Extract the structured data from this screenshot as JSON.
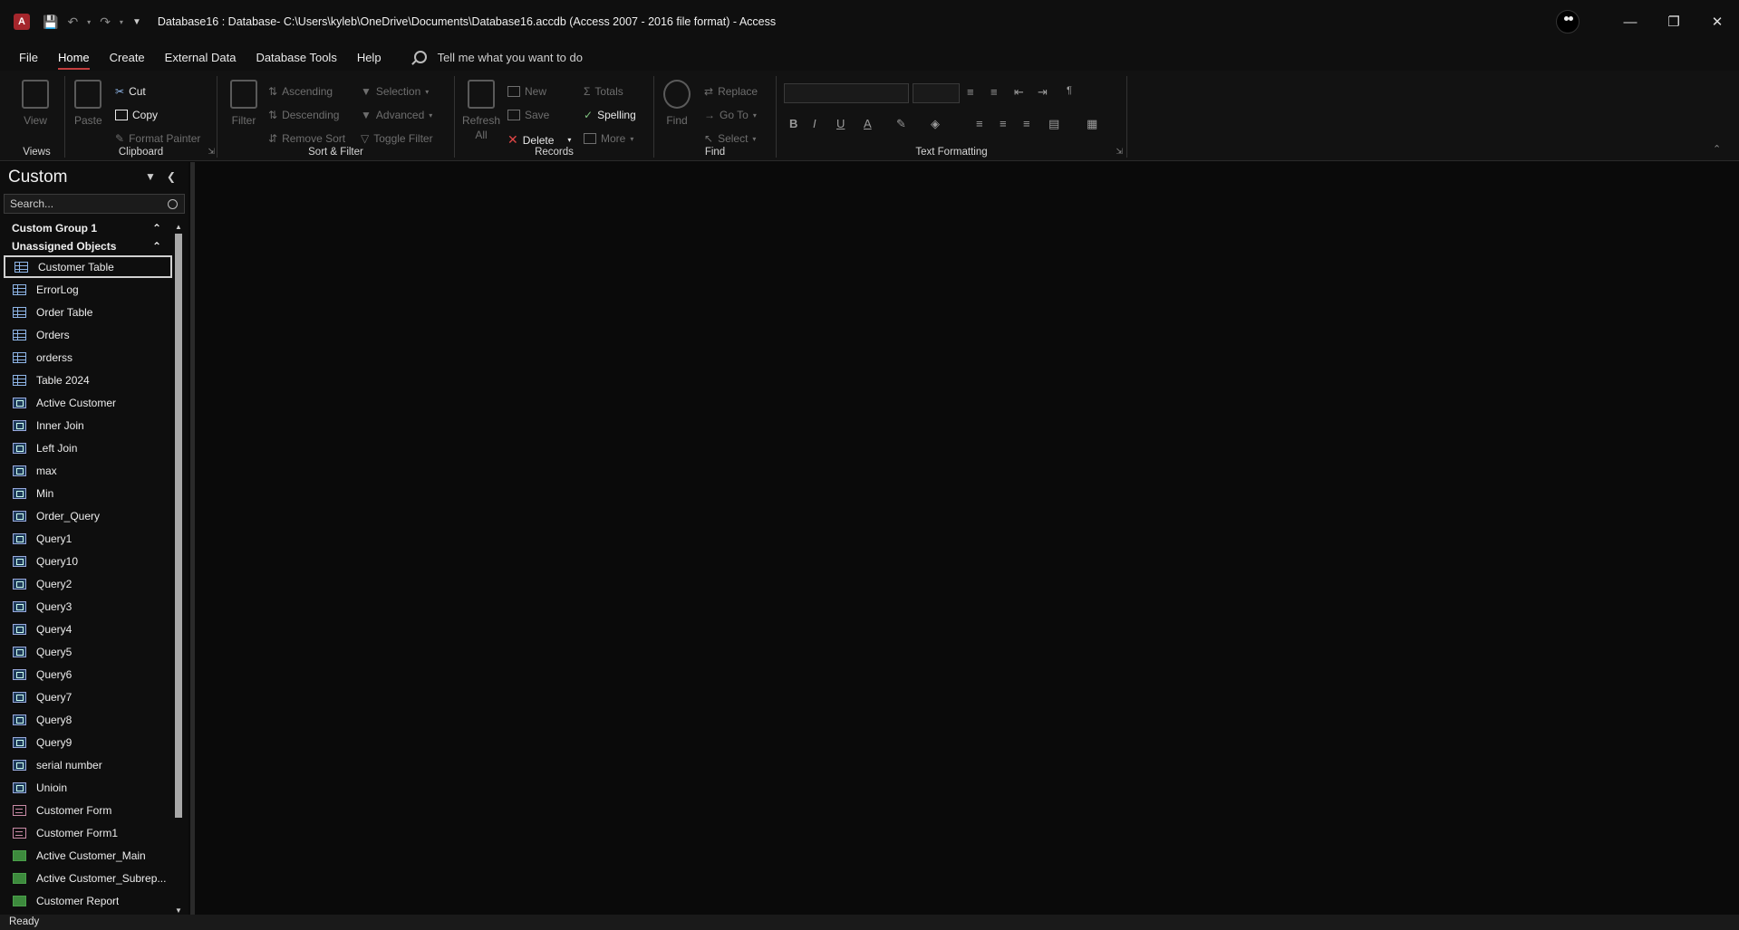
{
  "window": {
    "title": "Database16 : Database- C:\\Users\\kyleb\\OneDrive\\Documents\\Database16.accdb (Access 2007 - 2016 file format)  -  Access",
    "app_icon_letter": "A"
  },
  "menu": {
    "tabs": [
      {
        "label": "File"
      },
      {
        "label": "Home"
      },
      {
        "label": "Create"
      },
      {
        "label": "External Data"
      },
      {
        "label": "Database Tools"
      },
      {
        "label": "Help"
      }
    ],
    "active_tab": "Home",
    "tellme": "Tell me what you want to do"
  },
  "ribbon": {
    "views": {
      "label": "Views",
      "view": "View"
    },
    "clipboard": {
      "label": "Clipboard",
      "paste": "Paste",
      "cut": "Cut",
      "copy": "Copy",
      "format_painter": "Format Painter"
    },
    "sort_filter": {
      "label": "Sort & Filter",
      "filter": "Filter",
      "ascending": "Ascending",
      "descending": "Descending",
      "remove_sort": "Remove Sort",
      "selection": "Selection",
      "advanced": "Advanced",
      "toggle_filter": "Toggle Filter"
    },
    "records": {
      "label": "Records",
      "refresh": "Refresh",
      "refresh_all": "All",
      "new": "New",
      "save": "Save",
      "delete": "Delete",
      "totals": "Totals",
      "spelling": "Spelling",
      "more": "More"
    },
    "find": {
      "label": "Find",
      "find": "Find",
      "replace": "Replace",
      "goto": "Go To",
      "select": "Select"
    },
    "text_formatting": {
      "label": "Text Formatting",
      "bold": "B",
      "italic": "I",
      "underline": "U",
      "font_color": "A"
    }
  },
  "nav": {
    "title": "Custom",
    "search_placeholder": "Search...",
    "groups": [
      {
        "label": "Custom Group 1"
      },
      {
        "label": "Unassigned Objects"
      }
    ],
    "items": [
      {
        "label": "Customer Table",
        "type": "table"
      },
      {
        "label": "ErrorLog",
        "type": "table"
      },
      {
        "label": "Order Table",
        "type": "table"
      },
      {
        "label": "Orders",
        "type": "table"
      },
      {
        "label": "orderss",
        "type": "table"
      },
      {
        "label": "Table 2024",
        "type": "table"
      },
      {
        "label": "Active Customer",
        "type": "query"
      },
      {
        "label": "Inner Join",
        "type": "query"
      },
      {
        "label": "Left Join",
        "type": "query"
      },
      {
        "label": "max",
        "type": "query"
      },
      {
        "label": "Min",
        "type": "query"
      },
      {
        "label": "Order_Query",
        "type": "query"
      },
      {
        "label": "Query1",
        "type": "query"
      },
      {
        "label": "Query10",
        "type": "query"
      },
      {
        "label": "Query2",
        "type": "query"
      },
      {
        "label": "Query3",
        "type": "query"
      },
      {
        "label": "Query4",
        "type": "query"
      },
      {
        "label": "Query5",
        "type": "query"
      },
      {
        "label": "Query6",
        "type": "query"
      },
      {
        "label": "Query7",
        "type": "query"
      },
      {
        "label": "Query8",
        "type": "query"
      },
      {
        "label": "Query9",
        "type": "query"
      },
      {
        "label": "serial number",
        "type": "query"
      },
      {
        "label": "Unioin",
        "type": "query"
      },
      {
        "label": "Customer Form",
        "type": "form"
      },
      {
        "label": "Customer Form1",
        "type": "form"
      },
      {
        "label": "Active Customer_Main",
        "type": "report"
      },
      {
        "label": "Active Customer_Subrep...",
        "type": "report"
      },
      {
        "label": "Customer Report",
        "type": "report"
      }
    ],
    "selected": "Customer Table"
  },
  "status": {
    "text": "Ready"
  },
  "colors": {
    "accent": "#c43e3e",
    "bg": "#0a0a0a"
  }
}
